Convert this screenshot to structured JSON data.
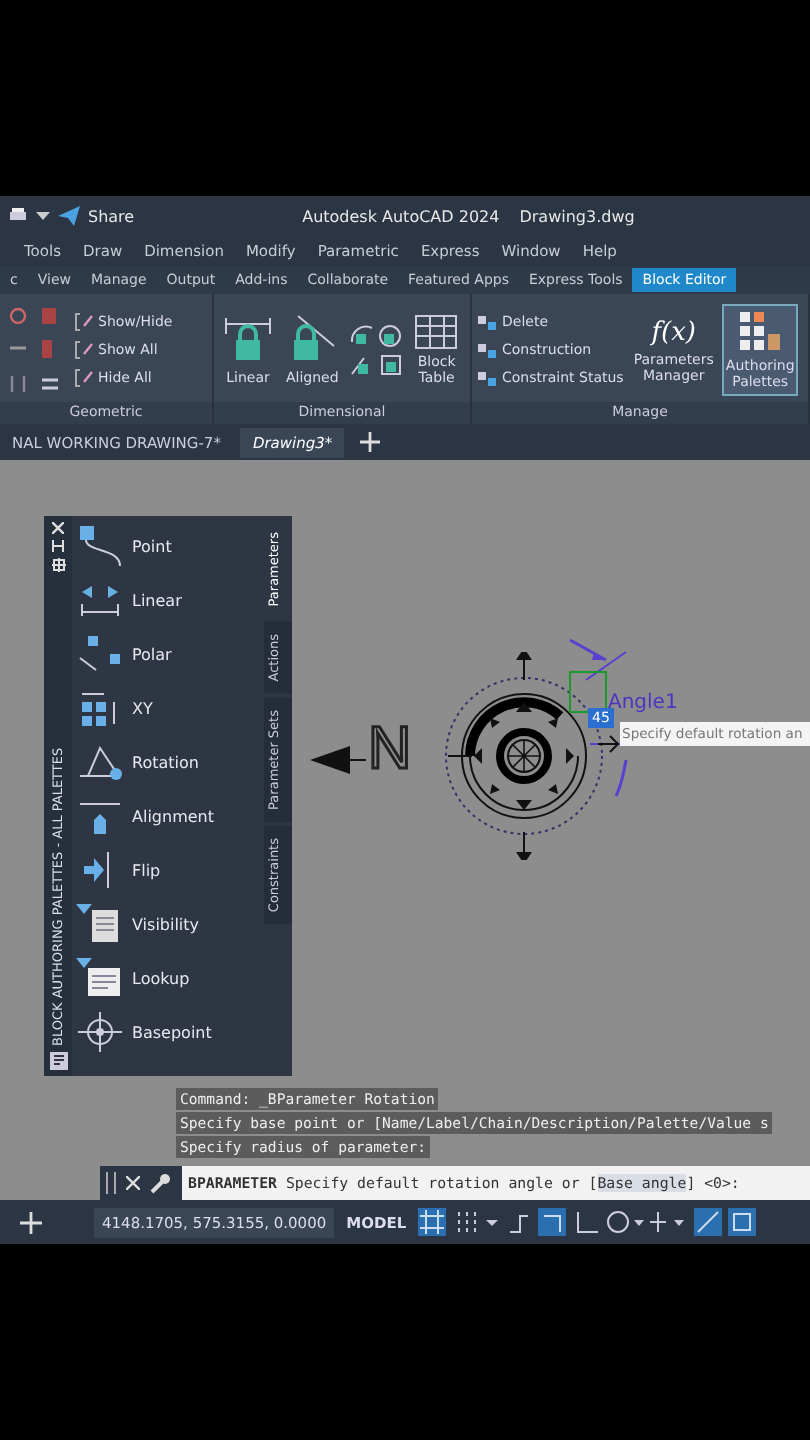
{
  "title_bar": {
    "share": "Share",
    "title": "Autodesk AutoCAD 2024",
    "file": "Drawing3.dwg"
  },
  "menu": [
    "Tools",
    "Draw",
    "Dimension",
    "Modify",
    "Parametric",
    "Express",
    "Window",
    "Help"
  ],
  "ribbon_tabs": [
    {
      "label": "c",
      "selected": false
    },
    {
      "label": "View",
      "selected": false
    },
    {
      "label": "Manage",
      "selected": false
    },
    {
      "label": "Output",
      "selected": false
    },
    {
      "label": "Add-ins",
      "selected": false
    },
    {
      "label": "Collaborate",
      "selected": false
    },
    {
      "label": "Featured Apps",
      "selected": false
    },
    {
      "label": "Express Tools",
      "selected": false
    },
    {
      "label": "Block Editor",
      "selected": true
    }
  ],
  "ribbon_panels": {
    "geometric": {
      "label": "Geometric",
      "buttons": [
        "Show/Hide",
        "Show All",
        "Hide All"
      ]
    },
    "dimensional": {
      "label": "Dimensional",
      "linear": "Linear",
      "aligned": "Aligned",
      "block_table": [
        "Block",
        "Table"
      ]
    },
    "manage": {
      "label": "Manage",
      "buttons": [
        "Delete",
        "Construction",
        "Constraint Status"
      ],
      "parameters_manager": [
        "Parameters",
        "Manager"
      ],
      "parameters_manager_icon": "f(x)",
      "authoring_palettes": {
        "label": [
          "Authoring",
          "Palettes"
        ],
        "selected": true
      }
    }
  },
  "file_tabs": [
    {
      "label": "NAL WORKING DRAWING-7*",
      "selected": false
    },
    {
      "label": "Drawing3*",
      "selected": true
    }
  ],
  "palette": {
    "title": "BLOCK AUTHORING PALETTES - ALL PALETTES",
    "items": [
      "Point",
      "Linear",
      "Polar",
      "XY",
      "Rotation",
      "Alignment",
      "Flip",
      "Visibility",
      "Lookup",
      "Basepoint"
    ],
    "tabs": [
      {
        "label": "Parameters",
        "selected": true
      },
      {
        "label": "Actions",
        "selected": false
      },
      {
        "label": "Parameter Sets",
        "selected": false
      },
      {
        "label": "Constraints",
        "selected": false
      }
    ]
  },
  "drawing": {
    "north": "N",
    "parameter_label": "Angle1",
    "angle_input": "45",
    "tooltip": "Specify default rotation an"
  },
  "command_history": [
    "Command:  _BParameter Rotation",
    "Specify base point or [Name/Label/Chain/Description/Palette/Value s",
    "Specify radius of parameter:"
  ],
  "command_line": {
    "command": "BPARAMETER",
    "prompt": "Specify default rotation angle or [",
    "option": "Base angle",
    "end": "] <0>:"
  },
  "status_bar": {
    "coordinates": "4148.1705, 575.3155, 0.0000",
    "space": "MODEL"
  }
}
